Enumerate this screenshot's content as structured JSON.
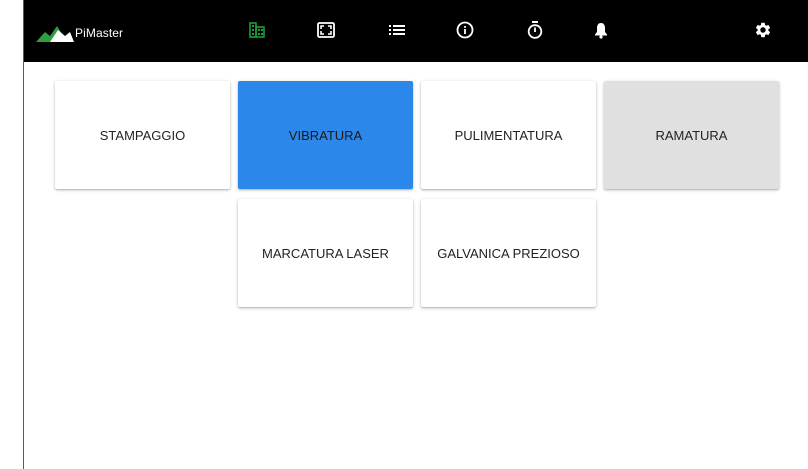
{
  "app": {
    "brand_name": "PiMaster",
    "colors": {
      "topbar": "#000000",
      "logo_green": "#2e9e3e",
      "active_icon": "#1f9d3a",
      "active_tile": "#2b87ea",
      "muted_tile": "#e0e0e0"
    }
  },
  "toolbar": {
    "icons": [
      {
        "name": "grid-building-icon",
        "active": true
      },
      {
        "name": "fullscreen-icon",
        "active": false
      },
      {
        "name": "list-icon",
        "active": false
      },
      {
        "name": "info-icon",
        "active": false
      },
      {
        "name": "stopwatch-icon",
        "active": false
      },
      {
        "name": "bell-icon",
        "active": false
      },
      {
        "name": "gear-icon",
        "active": false
      }
    ]
  },
  "tiles": [
    {
      "label": "STAMPAGGIO",
      "state": "normal"
    },
    {
      "label": "VIBRATURA",
      "state": "active"
    },
    {
      "label": "PULIMENTATURA",
      "state": "normal"
    },
    {
      "label": "RAMATURA",
      "state": "muted"
    },
    {
      "label": "MARCATURA LASER",
      "state": "normal"
    },
    {
      "label": "GALVANICA PREZIOSO",
      "state": "normal"
    }
  ]
}
